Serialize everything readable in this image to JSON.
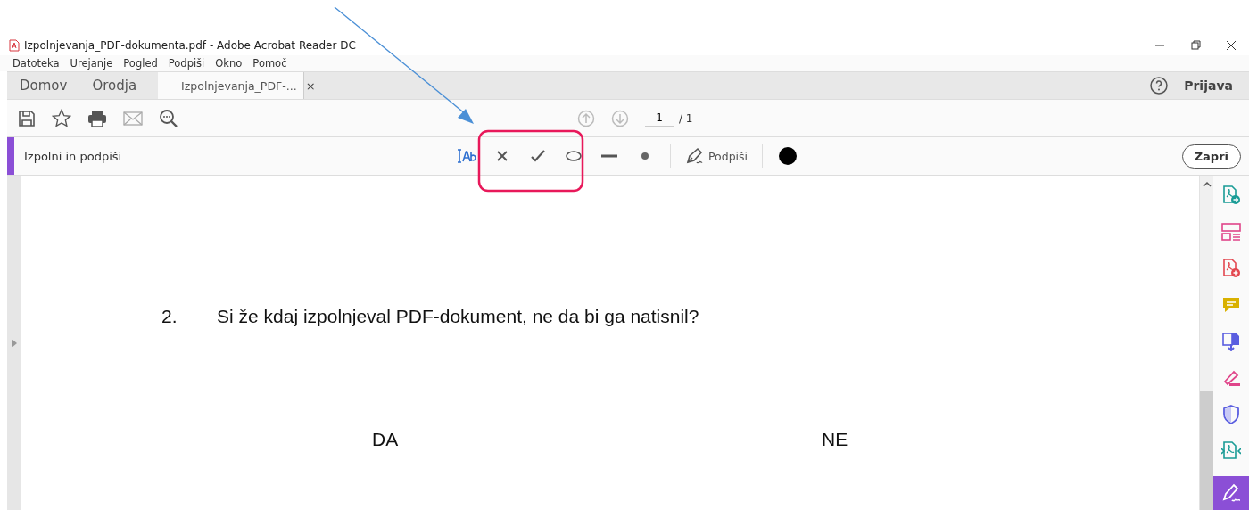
{
  "window": {
    "title": "Izpolnjevanja_PDF-dokumenta.pdf - Adobe Acrobat Reader DC"
  },
  "menu": [
    "Datoteka",
    "Urejanje",
    "Pogled",
    "Podpiši",
    "Okno",
    "Pomoč"
  ],
  "tabs": [
    {
      "label": "Domov",
      "selected": false
    },
    {
      "label": "Orodja",
      "selected": false
    },
    {
      "label": "Izpolnjevanja_PDF-...",
      "selected": true,
      "close": "×"
    }
  ],
  "account": {
    "label": "Prijava"
  },
  "toolbar": {
    "page_up_disabled": true,
    "page_down_disabled": true,
    "page": "1",
    "total": "/ 1"
  },
  "sign_bar": {
    "title": "Izpolni in podpiši",
    "tools": [
      {
        "kind": "text"
      },
      {
        "kind": "cross"
      },
      {
        "kind": "check"
      },
      {
        "kind": "ellipse"
      },
      {
        "kind": "line"
      },
      {
        "kind": "dot"
      },
      {
        "kind": "sign",
        "label": "Podpiši"
      },
      {
        "kind": "color",
        "color": "#000000"
      }
    ],
    "close": "Zapri"
  },
  "document": {
    "number": "2.",
    "question": "Si že kdaj izpolnjeval PDF-dokument, ne da bi ga natisnil?",
    "options": [
      "DA",
      "NE"
    ]
  },
  "rail": [
    {
      "kind": "export",
      "selected": false
    },
    {
      "kind": "organize",
      "selected": false
    },
    {
      "kind": "create",
      "selected": false
    },
    {
      "kind": "comment",
      "selected": false
    },
    {
      "kind": "combine",
      "selected": false
    },
    {
      "kind": "highlight",
      "selected": false
    },
    {
      "kind": "protect",
      "selected": false
    },
    {
      "kind": "compress",
      "selected": false
    },
    {
      "kind": "sign",
      "selected": true
    }
  ]
}
